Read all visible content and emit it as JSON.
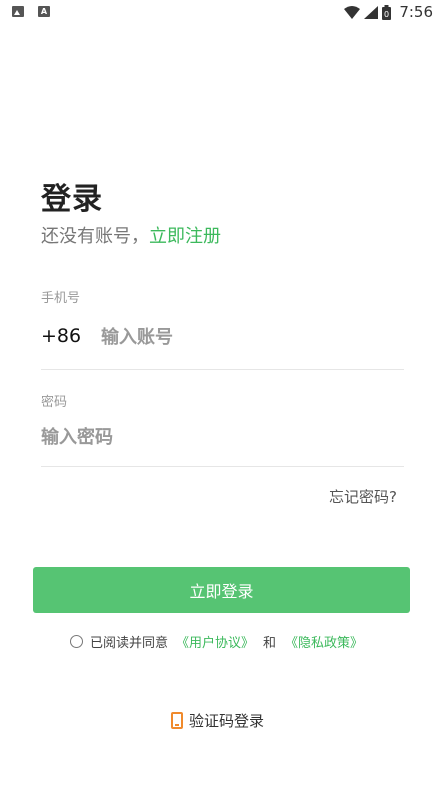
{
  "status_bar": {
    "time": "7:56",
    "battery_level": "0",
    "left_icons": [
      "image-icon",
      "a-icon"
    ],
    "right_icons": [
      "wifi-icon",
      "signal-icon",
      "battery-icon"
    ]
  },
  "header": {
    "title": "登录",
    "subtitle_prefix": "还没有账号，",
    "register_link": "立即注册"
  },
  "phone": {
    "label": "手机号",
    "country_code": "+86",
    "placeholder": "输入账号",
    "value": ""
  },
  "password": {
    "label": "密码",
    "placeholder": "输入密码",
    "value": ""
  },
  "forgot_password": "忘记密码?",
  "login_button": "立即登录",
  "agreement": {
    "checked": false,
    "text": "已阅读并同意",
    "user_agreement": "《用户协议》",
    "and": "和",
    "privacy_policy": "《隐私政策》"
  },
  "sms_login": {
    "label": "验证码登录",
    "icon": "mobile-phone-icon"
  },
  "colors": {
    "accent": "#3cb95c",
    "button": "#56c473",
    "sms_icon": "#f08a2c"
  }
}
